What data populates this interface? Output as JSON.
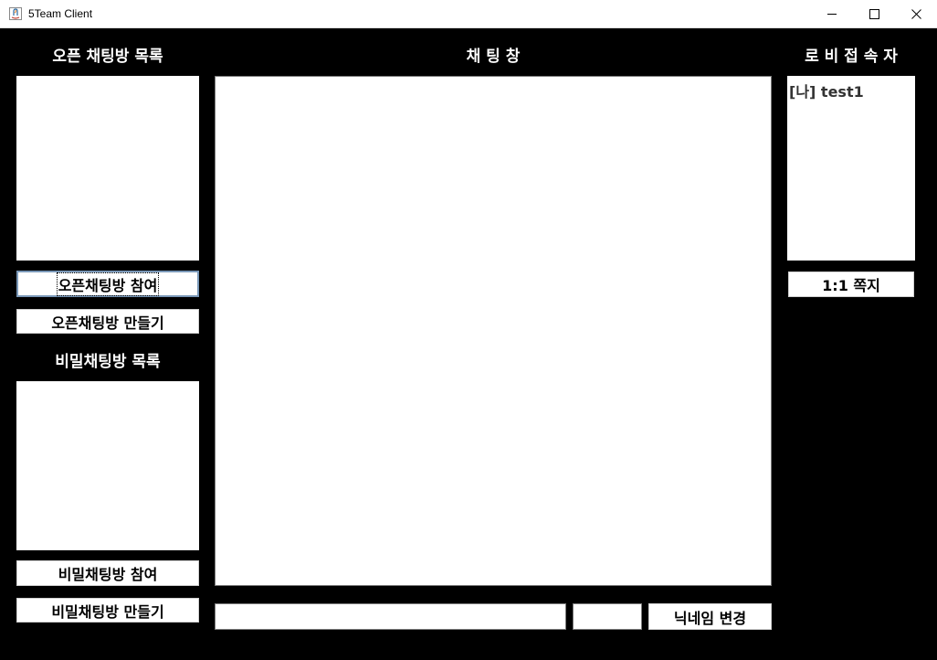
{
  "window": {
    "title": "5Team Client"
  },
  "left": {
    "open_list_heading": "오픈 채팅방 목록",
    "join_open_button": "오픈채팅방 참여",
    "create_open_button": "오픈채팅방 만들기",
    "secret_list_heading": "비밀채팅방 목록",
    "join_secret_button": "비밀채팅방 참여",
    "create_secret_button": "비밀채팅방 만들기"
  },
  "center": {
    "chat_heading": "채 팅 창",
    "message_input_value": "",
    "nickname_input_value": "",
    "change_nickname_button": "닉네임 변경"
  },
  "right": {
    "lobby_users_heading": "로 비 접 속 자",
    "users": [
      {
        "label": "[나] test1"
      }
    ],
    "direct_message_button": "1:1 쪽지"
  }
}
